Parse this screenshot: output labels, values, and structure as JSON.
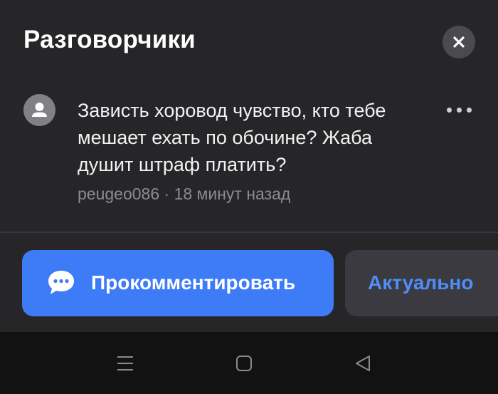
{
  "header": {
    "title": "Разговорчики",
    "close_icon": "close-icon"
  },
  "comment": {
    "avatar_icon": "user-icon",
    "text": "Зависть хоровод чувство, кто тебе мешает ехать по обочине? Жаба душит штраф платить?",
    "author": "peugeo086",
    "time": "18 минут назад",
    "meta": "peugeo086 · 18 минут назад",
    "menu_icon": "more-dots-icon"
  },
  "actions": {
    "comment_label": "Прокомментировать",
    "comment_icon": "chat-bubble-icon",
    "relevant_label": "Актуально"
  },
  "navbar": {
    "menu_icon": "menu-icon",
    "home_icon": "home-icon",
    "back_icon": "back-icon"
  },
  "colors": {
    "accent": "#3d7cf6",
    "link": "#4f8ef7",
    "background": "#262629"
  }
}
